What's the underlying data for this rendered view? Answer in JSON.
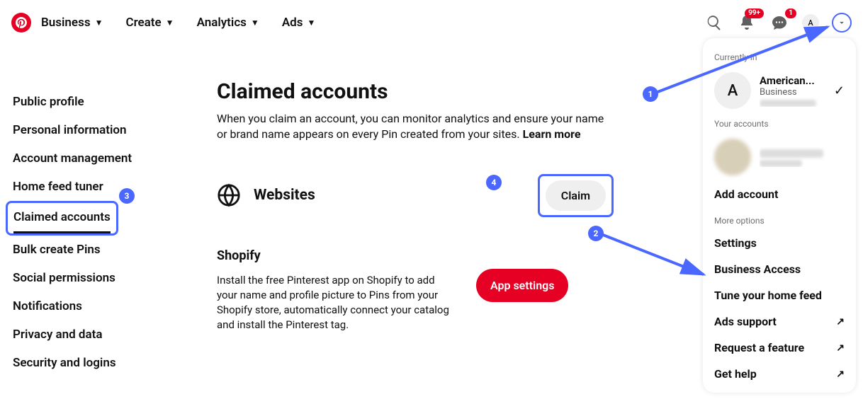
{
  "header": {
    "nav": [
      "Business",
      "Create",
      "Analytics",
      "Ads"
    ],
    "notif_badge": "99+",
    "msg_badge": "1",
    "avatar_letter": "A"
  },
  "sidebar": {
    "items": [
      "Public profile",
      "Personal information",
      "Account management",
      "Home feed tuner",
      "Claimed accounts",
      "Bulk create Pins",
      "Social permissions",
      "Notifications",
      "Privacy and data",
      "Security and logins"
    ],
    "active_index": 4
  },
  "main": {
    "title": "Claimed accounts",
    "desc": "When you claim an account, you can monitor analytics and ensure your name or brand name appears on every Pin created from your sites. ",
    "learn_more": "Learn more",
    "websites_label": "Websites",
    "claim_label": "Claim",
    "shopify_title": "Shopify",
    "shopify_desc": "Install the free Pinterest app on Shopify to add your name and profile picture to Pins from your Shopify store, automatically connect your catalog and install the Pinterest tag.",
    "app_settings": "App settings"
  },
  "dropdown": {
    "currently_in": "Currently in",
    "acct_name": "American...",
    "acct_type": "Business",
    "acct_letter": "A",
    "your_accounts": "Your accounts",
    "add_account": "Add account",
    "more_options": "More options",
    "options": [
      {
        "label": "Settings",
        "ext": false
      },
      {
        "label": "Business Access",
        "ext": false
      },
      {
        "label": "Tune your home feed",
        "ext": false
      },
      {
        "label": "Ads support",
        "ext": true
      },
      {
        "label": "Request a feature",
        "ext": true
      },
      {
        "label": "Get help",
        "ext": true
      }
    ]
  },
  "annotations": {
    "b1": "1",
    "b2": "2",
    "b3": "3",
    "b4": "4"
  }
}
